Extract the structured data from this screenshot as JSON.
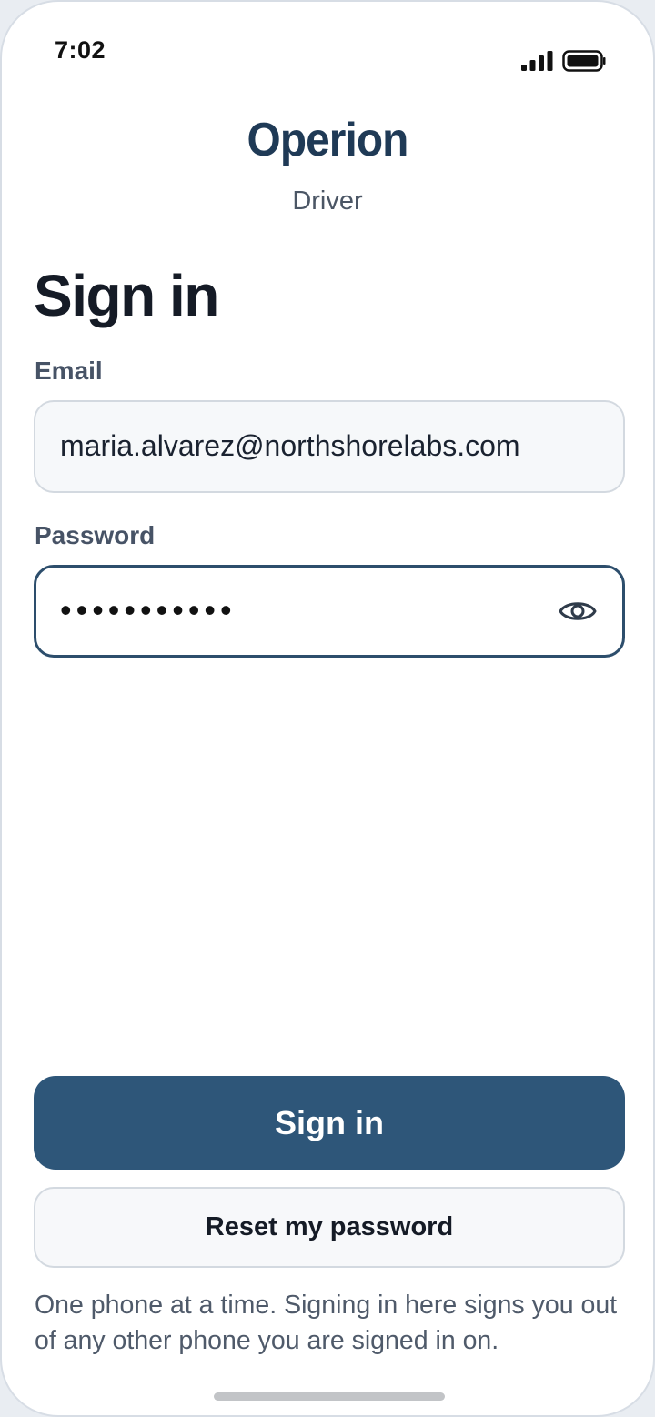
{
  "status_bar": {
    "time": "7:02",
    "icons": [
      "signal-icon",
      "battery-icon"
    ]
  },
  "brand": {
    "title": "Operion",
    "subtitle": "Driver"
  },
  "page": {
    "title": "Sign in"
  },
  "form": {
    "email": {
      "label": "Email",
      "value": "maria.alvarez@northshorelabs.com"
    },
    "password": {
      "label": "Password",
      "masked_value": "•••••••••••",
      "icon": "eye-icon"
    }
  },
  "actions": {
    "sign_in_label": "Sign in",
    "reset_label": "Reset my password"
  },
  "note": "One phone at a time. Signing in here signs you out of any other phone you are signed in on.",
  "colors": {
    "brand": "#1f3a56",
    "primary_button": "#2e5679",
    "focused_border": "#2d4e6c"
  }
}
